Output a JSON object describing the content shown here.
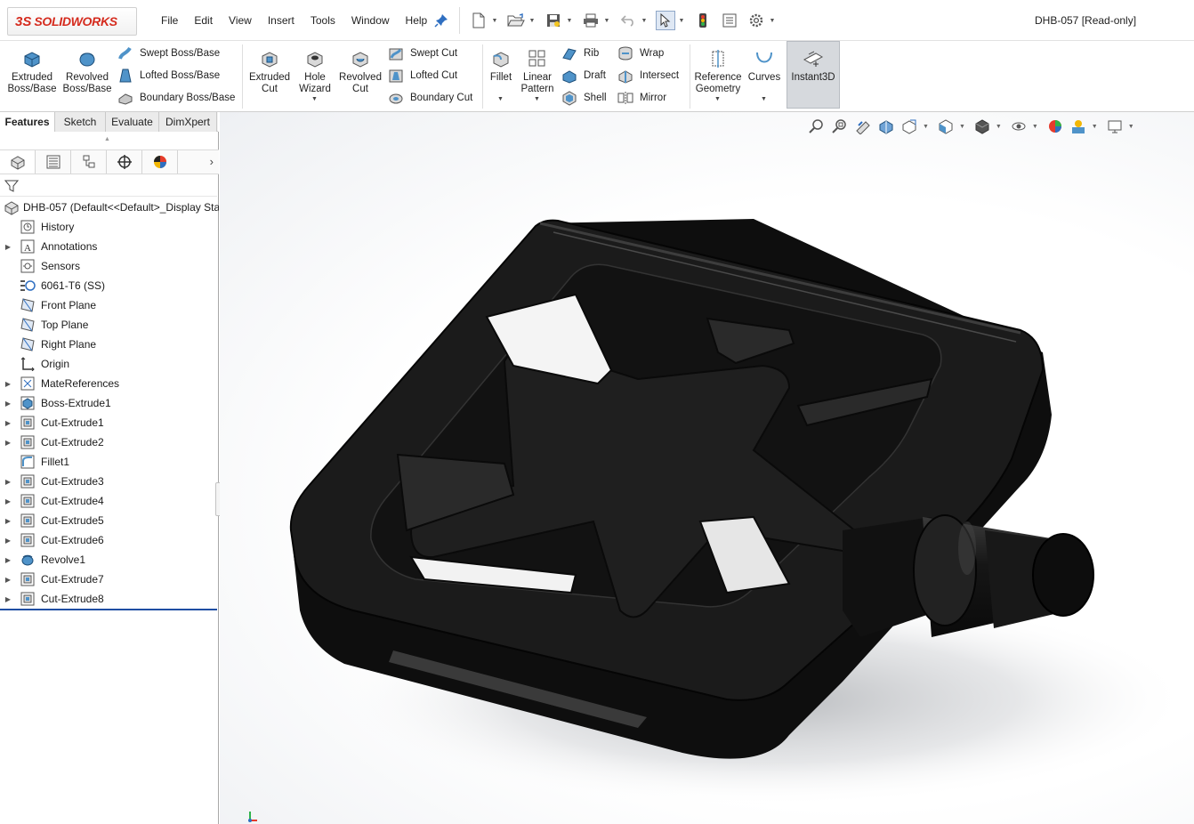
{
  "app": {
    "logo_prefix": "3S",
    "logo_name": "SOLIDWORKS",
    "document_title": "DHB-057 [Read-only]"
  },
  "menu": [
    "File",
    "Edit",
    "View",
    "Insert",
    "Tools",
    "Window",
    "Help"
  ],
  "quick_tools": [
    "new-document-icon",
    "open-icon",
    "save-icon",
    "print-icon",
    "undo-icon",
    "select-arrow-icon",
    "rebuild-traffic-light-icon",
    "file-properties-icon",
    "options-gear-icon"
  ],
  "command_manager": {
    "extruded_boss": "Extruded\nBoss/Base",
    "revolved_boss": "Revolved\nBoss/Base",
    "swept_boss": "Swept Boss/Base",
    "lofted_boss": "Lofted Boss/Base",
    "boundary_boss": "Boundary Boss/Base",
    "extruded_cut": "Extruded\nCut",
    "hole_wizard": "Hole\nWizard",
    "revolved_cut": "Revolved\nCut",
    "swept_cut": "Swept Cut",
    "lofted_cut": "Lofted Cut",
    "boundary_cut": "Boundary Cut",
    "fillet": "Fillet",
    "linear_pattern": "Linear\nPattern",
    "rib": "Rib",
    "draft": "Draft",
    "shell": "Shell",
    "wrap": "Wrap",
    "intersect": "Intersect",
    "mirror": "Mirror",
    "reference_geometry": "Reference\nGeometry",
    "curves": "Curves",
    "instant3d": "Instant3D"
  },
  "tabs": [
    "Features",
    "Sketch",
    "Evaluate",
    "DimXpert"
  ],
  "active_tab": "Features",
  "panel_tabs": [
    "featuremanager-icon",
    "propertymanager-icon",
    "configurationmanager-icon",
    "dimxpertmanager-icon",
    "displaymanager-icon"
  ],
  "tree": {
    "root": "DHB-057  (Default<<Default>_Display Sta",
    "items": [
      {
        "label": "History",
        "icon": "history-icon",
        "expandable": false
      },
      {
        "label": "Annotations",
        "icon": "annotations-icon",
        "expandable": true
      },
      {
        "label": "Sensors",
        "icon": "sensors-icon",
        "expandable": false
      },
      {
        "label": "6061-T6 (SS)",
        "icon": "material-icon",
        "expandable": false
      },
      {
        "label": "Front Plane",
        "icon": "plane-icon",
        "expandable": false
      },
      {
        "label": "Top Plane",
        "icon": "plane-icon",
        "expandable": false
      },
      {
        "label": "Right Plane",
        "icon": "plane-icon",
        "expandable": false
      },
      {
        "label": "Origin",
        "icon": "origin-icon",
        "expandable": false
      },
      {
        "label": "MateReferences",
        "icon": "mate-references-icon",
        "expandable": true
      },
      {
        "label": "Boss-Extrude1",
        "icon": "boss-extrude-icon",
        "expandable": true
      },
      {
        "label": "Cut-Extrude1",
        "icon": "cut-extrude-icon",
        "expandable": true
      },
      {
        "label": "Cut-Extrude2",
        "icon": "cut-extrude-icon",
        "expandable": true
      },
      {
        "label": "Fillet1",
        "icon": "fillet-icon",
        "expandable": false
      },
      {
        "label": "Cut-Extrude3",
        "icon": "cut-extrude-icon",
        "expandable": true
      },
      {
        "label": "Cut-Extrude4",
        "icon": "cut-extrude-icon",
        "expandable": true
      },
      {
        "label": "Cut-Extrude5",
        "icon": "cut-extrude-icon",
        "expandable": true
      },
      {
        "label": "Cut-Extrude6",
        "icon": "cut-extrude-icon",
        "expandable": true
      },
      {
        "label": "Revolve1",
        "icon": "revolve-icon",
        "expandable": true
      },
      {
        "label": "Cut-Extrude7",
        "icon": "cut-extrude-icon",
        "expandable": true
      },
      {
        "label": "Cut-Extrude8",
        "icon": "cut-extrude-icon",
        "expandable": true
      }
    ]
  },
  "heads_up_toolbar": [
    "zoom-to-fit-icon",
    "zoom-to-area-icon",
    "previous-view-icon",
    "section-view-icon",
    "dynamic-annotation-views-icon",
    "view-orientation-icon",
    "display-style-icon",
    "hide-show-items-icon",
    "edit-appearance-icon",
    "apply-scene-icon",
    "view-settings-icon"
  ],
  "colors": {
    "brand_red": "#d52b1e",
    "model_body": "#141414",
    "accent_blue": "#1f4ea3"
  }
}
